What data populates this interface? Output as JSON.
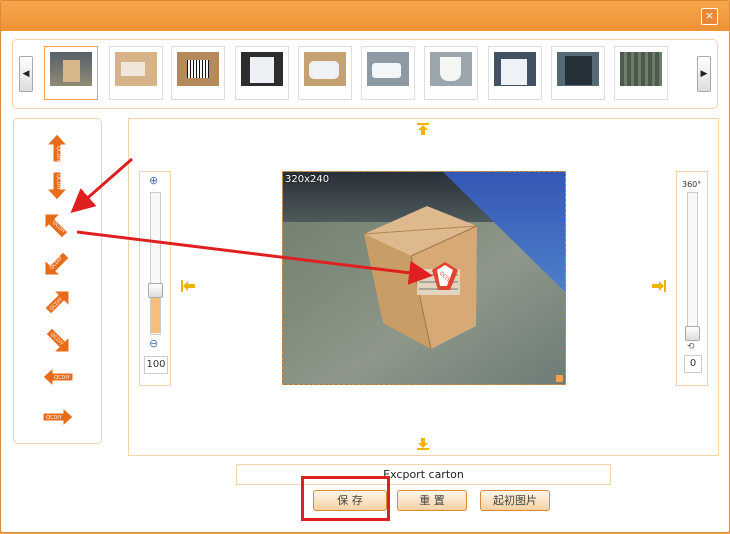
{
  "window": {
    "close_label": "×"
  },
  "gallery": {
    "prev_label": "◀",
    "next_label": "▶"
  },
  "tools": [
    {
      "label": "QCDIY"
    },
    {
      "label": "QCDIY"
    },
    {
      "label": "QCDIY"
    },
    {
      "label": "QCDIY"
    },
    {
      "label": "QCDIY"
    },
    {
      "label": "QCDIY"
    },
    {
      "label": "QCDIY"
    },
    {
      "label": "QCDIY"
    }
  ],
  "zoom": {
    "value": "100"
  },
  "rotation": {
    "max_label": "360°",
    "value": "0"
  },
  "image": {
    "size_label": "320x240",
    "sticker_label": "QCDIY"
  },
  "caption": {
    "text": "Excport carton"
  },
  "buttons": {
    "save": "保 存",
    "reset": "重 置",
    "original": "起初图片"
  },
  "colors": {
    "accent": "#f0a24c",
    "arrow": "#e86b1a",
    "annotation": "#e02020"
  }
}
